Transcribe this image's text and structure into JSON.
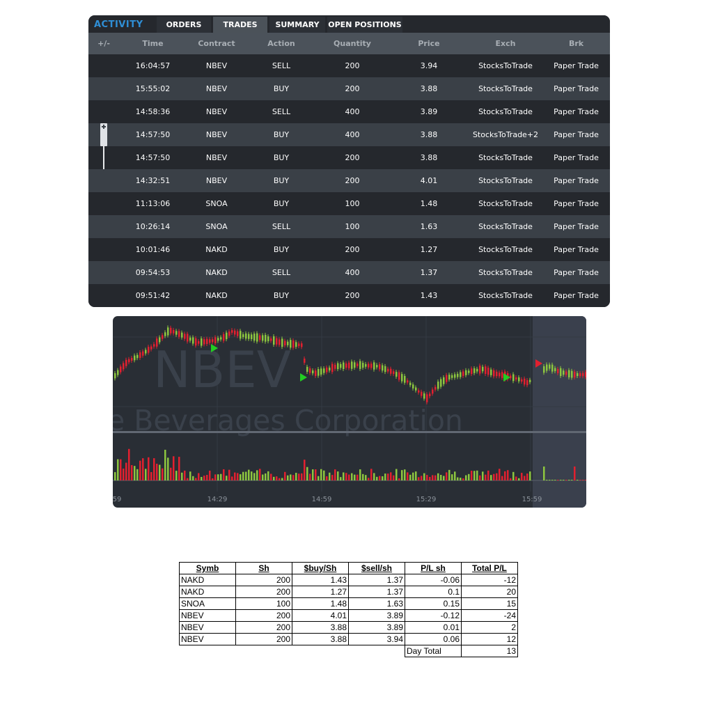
{
  "activity": {
    "title": "ACTIVITY",
    "tabs": [
      {
        "label": "ORDERS",
        "active": false
      },
      {
        "label": "TRADES",
        "active": true
      },
      {
        "label": "SUMMARY",
        "active": false
      },
      {
        "label": "OPEN POSITIONS",
        "active": false
      }
    ],
    "columns": [
      "+/-",
      "Time",
      "Contract",
      "Action",
      "Quantity",
      "Price",
      "Exch",
      "Brk"
    ],
    "rows": [
      {
        "time": "16:04:57",
        "contract": "NBEV",
        "action": "SELL",
        "quantity": "200",
        "price": "3.94",
        "exch": "StocksToTrade",
        "brk": "Paper Trade",
        "marker": ""
      },
      {
        "time": "15:55:02",
        "contract": "NBEV",
        "action": "BUY",
        "quantity": "200",
        "price": "3.88",
        "exch": "StocksToTrade",
        "brk": "Paper Trade",
        "marker": ""
      },
      {
        "time": "14:58:36",
        "contract": "NBEV",
        "action": "SELL",
        "quantity": "400",
        "price": "3.89",
        "exch": "StocksToTrade",
        "brk": "Paper Trade",
        "marker": ""
      },
      {
        "time": "14:57:50",
        "contract": "NBEV",
        "action": "BUY",
        "quantity": "400",
        "price": "3.88",
        "exch": "StocksToTrade+2",
        "brk": "Paper Trade",
        "marker": "expand"
      },
      {
        "time": "14:57:50",
        "contract": "NBEV",
        "action": "BUY",
        "quantity": "200",
        "price": "3.88",
        "exch": "StocksToTrade",
        "brk": "Paper Trade",
        "marker": "child"
      },
      {
        "time": "14:32:51",
        "contract": "NBEV",
        "action": "BUY",
        "quantity": "200",
        "price": "4.01",
        "exch": "StocksToTrade",
        "brk": "Paper Trade",
        "marker": ""
      },
      {
        "time": "11:13:06",
        "contract": "SNOA",
        "action": "BUY",
        "quantity": "100",
        "price": "1.48",
        "exch": "StocksToTrade",
        "brk": "Paper Trade",
        "marker": ""
      },
      {
        "time": "10:26:14",
        "contract": "SNOA",
        "action": "SELL",
        "quantity": "100",
        "price": "1.63",
        "exch": "StocksToTrade",
        "brk": "Paper Trade",
        "marker": ""
      },
      {
        "time": "10:01:46",
        "contract": "NAKD",
        "action": "BUY",
        "quantity": "200",
        "price": "1.27",
        "exch": "StocksToTrade",
        "brk": "Paper Trade",
        "marker": ""
      },
      {
        "time": "09:54:53",
        "contract": "NAKD",
        "action": "SELL",
        "quantity": "400",
        "price": "1.37",
        "exch": "StocksToTrade",
        "brk": "Paper Trade",
        "marker": ""
      },
      {
        "time": "09:51:42",
        "contract": "NAKD",
        "action": "BUY",
        "quantity": "200",
        "price": "1.43",
        "exch": "StocksToTrade",
        "brk": "Paper Trade",
        "marker": ""
      }
    ]
  },
  "chart": {
    "symbol": "NBEV",
    "company": "e Beverages Corporation",
    "time_ticks": [
      "59",
      "14:29",
      "14:59",
      "15:29",
      "15:59"
    ],
    "colors": {
      "up": "#8dc63f",
      "down": "#e2202f",
      "buy_marker": "#22cc22",
      "sell_marker": "#e2202f",
      "after_hours": "#3a404d"
    }
  },
  "pl_table": {
    "headers": [
      "Symb",
      "Sh",
      "$buy/Sh",
      "$sell/sh",
      "P/L sh",
      "Total P/L"
    ],
    "rows": [
      [
        "NAKD",
        "200",
        "1.43",
        "1.37",
        "-0.06",
        "-12"
      ],
      [
        "NAKD",
        "200",
        "1.27",
        "1.37",
        "0.1",
        "20"
      ],
      [
        "SNOA",
        "100",
        "1.48",
        "1.63",
        "0.15",
        "15"
      ],
      [
        "NBEV",
        "200",
        "4.01",
        "3.89",
        "-0.12",
        "-24"
      ],
      [
        "NBEV",
        "200",
        "3.88",
        "3.89",
        "0.01",
        "2"
      ],
      [
        "NBEV",
        "200",
        "3.88",
        "3.94",
        "0.06",
        "12"
      ]
    ],
    "day_total_label": "Day Total",
    "day_total_value": "13"
  }
}
